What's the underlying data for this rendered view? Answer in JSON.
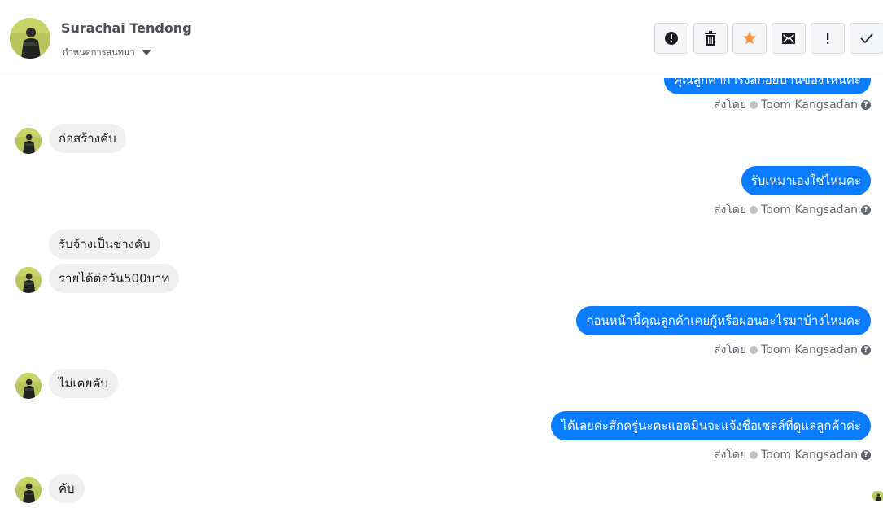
{
  "header": {
    "name": "Surachai Tendong",
    "subtitle": "กำหนดการสนทนา",
    "actions": [
      {
        "icon": "alert-icon"
      },
      {
        "icon": "trash-icon"
      },
      {
        "icon": "star-icon"
      },
      {
        "icon": "mail-icon"
      },
      {
        "icon": "exclamation-icon"
      },
      {
        "icon": "check-icon"
      }
    ]
  },
  "colors": {
    "outgoing_bubble": "#0a7cff",
    "incoming_bubble": "#f1f0f0",
    "star": "#f7923a"
  },
  "messages": {
    "top_cut": "คุณลูกค้ากำรังสกอยบ้านของไหนคะ",
    "sent_label": "ส่งโดย",
    "agent": "Toom Kangsadan",
    "m1": "ก่อสร้างคับ",
    "m2": "รับเหมาเองใช่ไหมคะ",
    "m3": "รับจ้างเป็นช่างคับ",
    "m4": "รายได้ต่อวัน500บาท",
    "m5": "ก่อนหน้านี้คุณลูกค้าเคยกู้หรือผ่อนอะไรมาบ้างไหมคะ",
    "m6": "ไม่เคยคับ",
    "m7": "ได้เลยค่ะสักครู่นะคะแอดมินจะแจ้งชื่อเซลล์ที่ดูแลลูกค้าค่ะ",
    "m8": "คับ"
  }
}
